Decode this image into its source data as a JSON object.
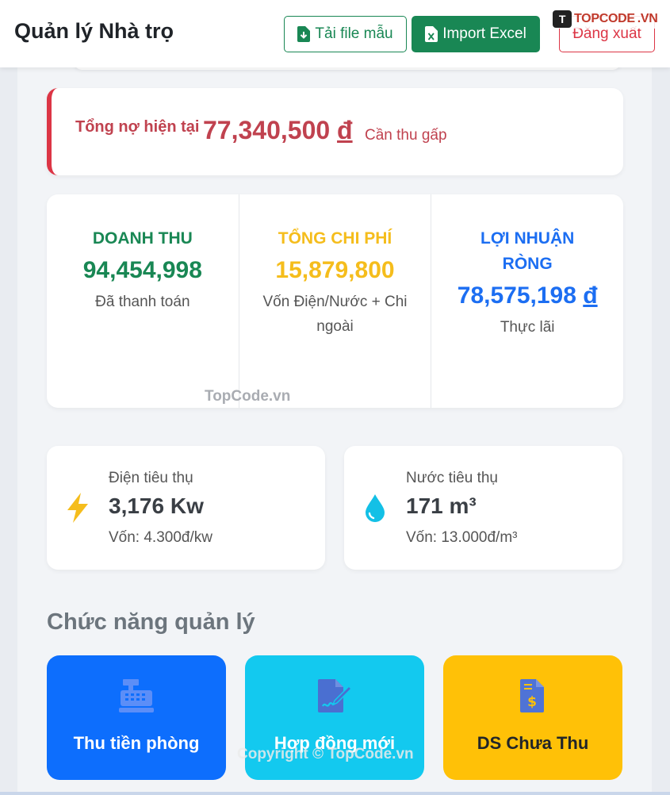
{
  "header": {
    "title": "Quản lý Nhà trọ",
    "buttons": {
      "download_template": "Tải file mẫu",
      "import_excel": "Import Excel",
      "logout": "Đăng xuất"
    },
    "logo_text": "TOPCODE",
    "logo_suffix": ".VN",
    "logo_mark": "T"
  },
  "debt": {
    "label": "Tổng nợ hiện tại",
    "amount": "77,340,500",
    "currency": "đ",
    "note": "Cần thu gấp"
  },
  "finance": {
    "revenue": {
      "title": "DOANH THU",
      "value": "94,454,998",
      "sub": "Đã thanh toán"
    },
    "expense": {
      "title": "TỔNG CHI PHÍ",
      "value": "15,879,800",
      "sub": "Vốn Điện/Nước + Chi ngoài"
    },
    "profit": {
      "title": "LỢI NHUẬN RÒNG",
      "value": "78,575,198",
      "currency": "đ",
      "sub": "Thực lãi"
    }
  },
  "utilities": {
    "electricity": {
      "label": "Điện tiêu thụ",
      "value": "3,176 Kw",
      "cost": "Vốn: 4.300đ/kw",
      "icon": "bolt-icon"
    },
    "water": {
      "label": "Nước tiêu thụ",
      "value": "171 m³",
      "cost": "Vốn: 13.000đ/m³",
      "icon": "water-drop-icon"
    }
  },
  "functions": {
    "title": "Chức năng quản lý",
    "tiles": [
      {
        "label": "Thu tiền phòng",
        "icon": "cash-register-icon",
        "color": "#0d6efd"
      },
      {
        "label": "Hợp đồng mới",
        "icon": "contract-sign-icon",
        "color": "#13c9ef"
      },
      {
        "label": "DS Chưa Thu",
        "icon": "invoice-dollar-icon",
        "color": "#ffc107"
      }
    ]
  },
  "watermarks": {
    "middle": "TopCode.vn",
    "bottom": "Copyright © TopCode.vn"
  },
  "colors": {
    "success": "#198754",
    "danger": "#dc3545",
    "warning": "#f5bd1c",
    "primary": "#1c6ef2"
  }
}
